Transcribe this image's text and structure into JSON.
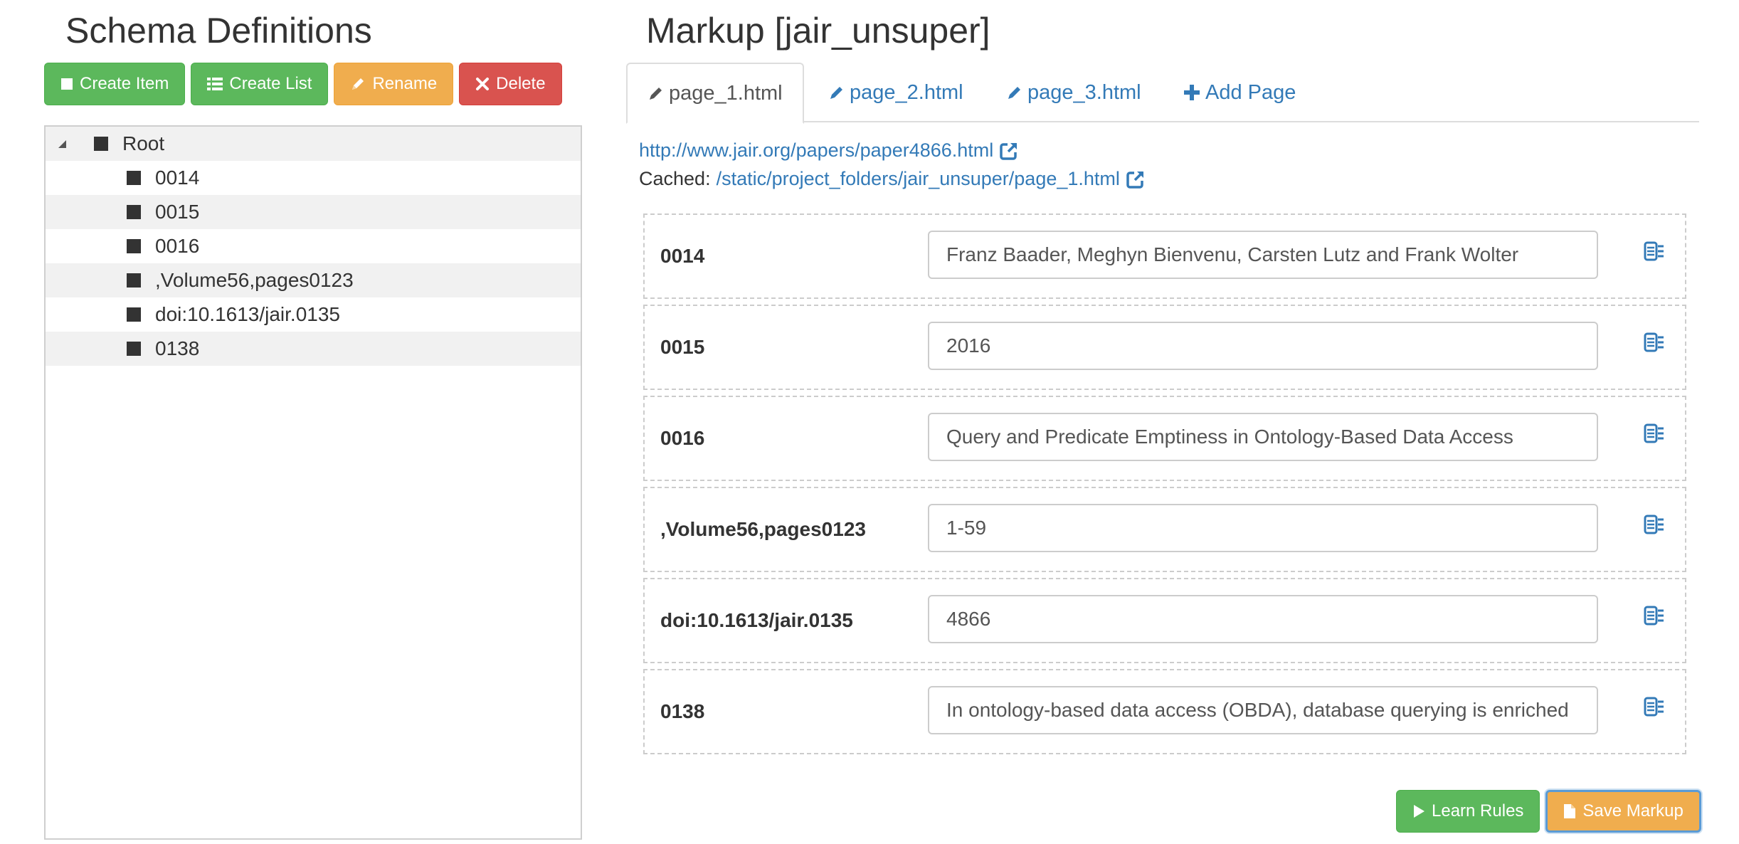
{
  "schema": {
    "title": "Schema Definitions",
    "buttons": {
      "create_item": "Create Item",
      "create_list": "Create List",
      "rename": "Rename",
      "delete": "Delete"
    },
    "tree": {
      "root": "Root",
      "items": [
        "0014",
        "0015",
        "0016",
        ",Volume56,pages0123",
        "doi:10.1613/jair.0135",
        "0138"
      ]
    }
  },
  "markup": {
    "title": "Markup [jair_unsuper]",
    "tabs": [
      {
        "label": "page_1.html",
        "icon": "pencil-icon",
        "active": true
      },
      {
        "label": "page_2.html",
        "icon": "pencil-icon",
        "active": false
      },
      {
        "label": "page_3.html",
        "icon": "pencil-icon",
        "active": false
      },
      {
        "label": "Add Page",
        "icon": "plus-icon",
        "active": false
      }
    ],
    "url": "http://www.jair.org/papers/paper4866.html",
    "cached_label": "Cached:",
    "cached_url": "/static/project_folders/jair_unsuper/page_1.html",
    "fields": [
      {
        "label": "0014",
        "value": "Franz Baader, Meghyn Bienvenu, Carsten Lutz and Frank Wolter"
      },
      {
        "label": "0015",
        "value": "2016"
      },
      {
        "label": "0016",
        "value": "Query and Predicate Emptiness in Ontology-Based Data Access"
      },
      {
        "label": ",Volume56,pages0123",
        "value": "1-59"
      },
      {
        "label": "doi:10.1613/jair.0135",
        "value": "4866"
      },
      {
        "label": "0138",
        "value": "In ontology-based data access (OBDA), database querying is enriched"
      }
    ],
    "buttons": {
      "learn_rules": "Learn Rules",
      "save_markup": "Save Markup"
    }
  },
  "colors": {
    "green": "#5cb85c",
    "orange": "#f0ad4e",
    "red": "#d9534f",
    "link": "#337ab7"
  }
}
